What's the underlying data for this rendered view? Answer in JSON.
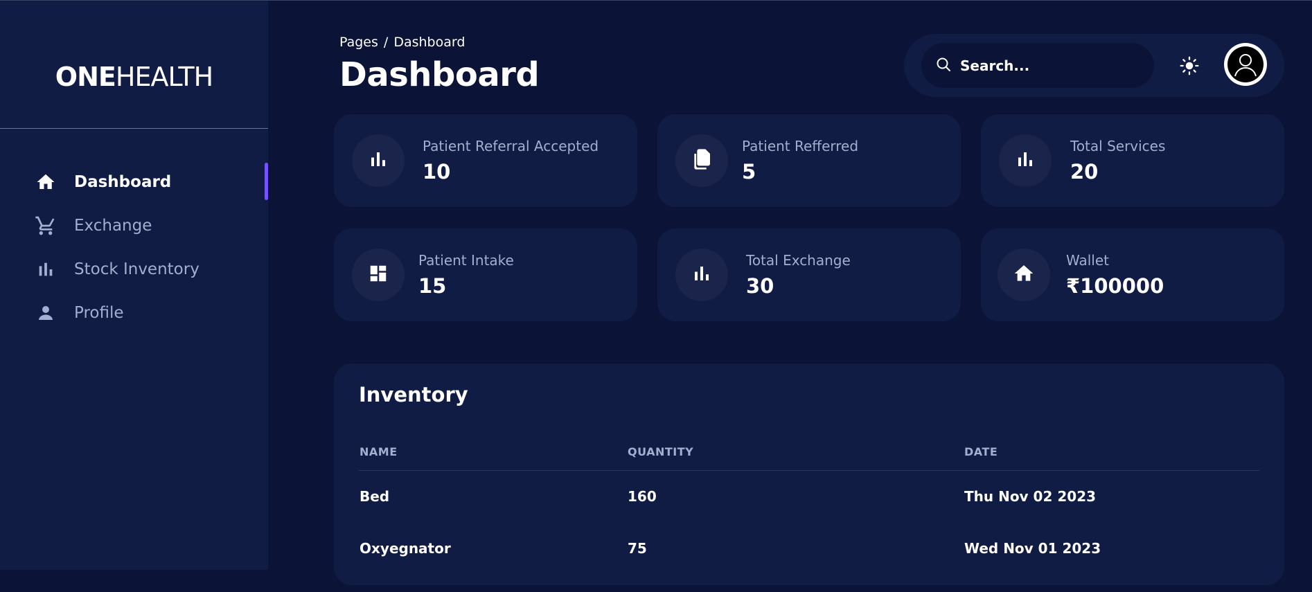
{
  "brand": {
    "bold": "ONE",
    "light": "HEALTH"
  },
  "sidebar": {
    "items": [
      {
        "label": "Dashboard",
        "icon": "home-icon",
        "active": true
      },
      {
        "label": "Exchange",
        "icon": "cart-icon",
        "active": false
      },
      {
        "label": "Stock Inventory",
        "icon": "bar-chart-icon",
        "active": false
      },
      {
        "label": "Profile",
        "icon": "person-icon",
        "active": false
      }
    ]
  },
  "header": {
    "breadcrumb": {
      "root": "Pages",
      "separator": "/",
      "current": "Dashboard"
    },
    "title": "Dashboard",
    "search_placeholder": "Search..."
  },
  "stats": [
    {
      "label": "Patient Referral Accepted",
      "value": "10",
      "icon": "bar-chart-icon"
    },
    {
      "label": "Patient Refferred",
      "value": "5",
      "icon": "documents-icon"
    },
    {
      "label": "Total Services",
      "value": "20",
      "icon": "bar-chart-icon"
    },
    {
      "label": "Patient Intake",
      "value": "15",
      "icon": "dashboard-grid-icon"
    },
    {
      "label": "Total Exchange",
      "value": "30",
      "icon": "bar-chart-icon"
    },
    {
      "label": "Wallet",
      "value": "₹100000",
      "icon": "home-icon"
    }
  ],
  "inventory": {
    "title": "Inventory",
    "columns": [
      "NAME",
      "QUANTITY",
      "DATE"
    ],
    "rows": [
      {
        "name": "Bed",
        "quantity": "160",
        "date": "Thu Nov 02 2023"
      },
      {
        "name": "Oxyegnator",
        "quantity": "75",
        "date": "Wed Nov 01 2023"
      }
    ]
  },
  "colors": {
    "background": "#0b1437",
    "panel": "#111c44",
    "accent": "#7551ff",
    "muted_text": "#a3aed0"
  }
}
